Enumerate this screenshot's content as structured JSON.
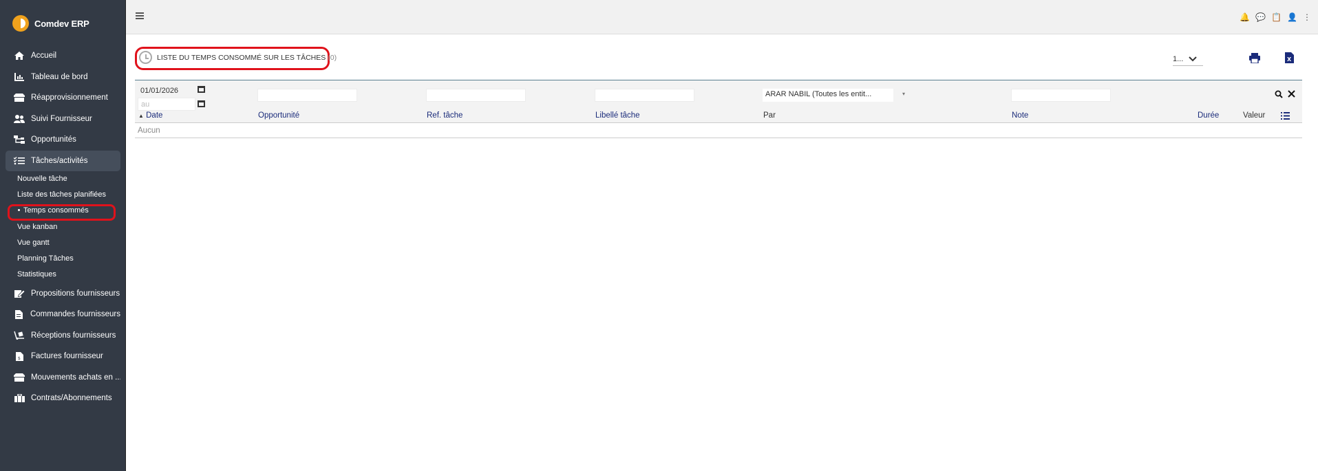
{
  "brand": {
    "name": "Comdev ERP"
  },
  "sidebar": {
    "items": [
      {
        "label": "Accueil",
        "icon": "home-icon"
      },
      {
        "label": "Tableau de bord",
        "icon": "chart-icon"
      },
      {
        "label": "Réapprovisionnement",
        "icon": "box-icon"
      },
      {
        "label": "Suivi Fournisseur",
        "icon": "users-icon"
      },
      {
        "label": "Opportunités",
        "icon": "sitemap-icon"
      },
      {
        "label": "Tâches/activités",
        "icon": "tasks-icon"
      }
    ],
    "subitems": [
      {
        "label": "Nouvelle tâche"
      },
      {
        "label": "Liste des tâches planifiées"
      },
      {
        "label": "Temps consommés"
      },
      {
        "label": "Vue kanban"
      },
      {
        "label": "Vue gantt"
      },
      {
        "label": "Planning Tâches"
      },
      {
        "label": "Statistiques"
      }
    ],
    "items2": [
      {
        "label": "Propositions fournisseurs",
        "icon": "edit-icon"
      },
      {
        "label": "Commandes fournisseurs",
        "icon": "file-icon"
      },
      {
        "label": "Réceptions fournisseurs",
        "icon": "dolly-icon"
      },
      {
        "label": "Factures fournisseur",
        "icon": "invoice-icon"
      },
      {
        "label": "Mouvements achats en ...",
        "icon": "box-icon"
      },
      {
        "label": "Contrats/Abonnements",
        "icon": "briefcase-icon"
      }
    ]
  },
  "page": {
    "title": "LISTE DU TEMPS CONSOMMÉ SUR LES TÂCHES",
    "count": "(0)",
    "pager_value": "1..."
  },
  "filters": {
    "date_from": "01/01/2026",
    "date_to_placeholder": "au",
    "par_value": "ARAR NABIL (Toutes les entit..."
  },
  "columns": {
    "date": "Date",
    "opportunite": "Opportunité",
    "ref_tache": "Ref. tâche",
    "libelle_tache": "Libellé tâche",
    "par": "Par",
    "note": "Note",
    "duree": "Durée",
    "valeur": "Valeur"
  },
  "empty_text": "Aucun"
}
